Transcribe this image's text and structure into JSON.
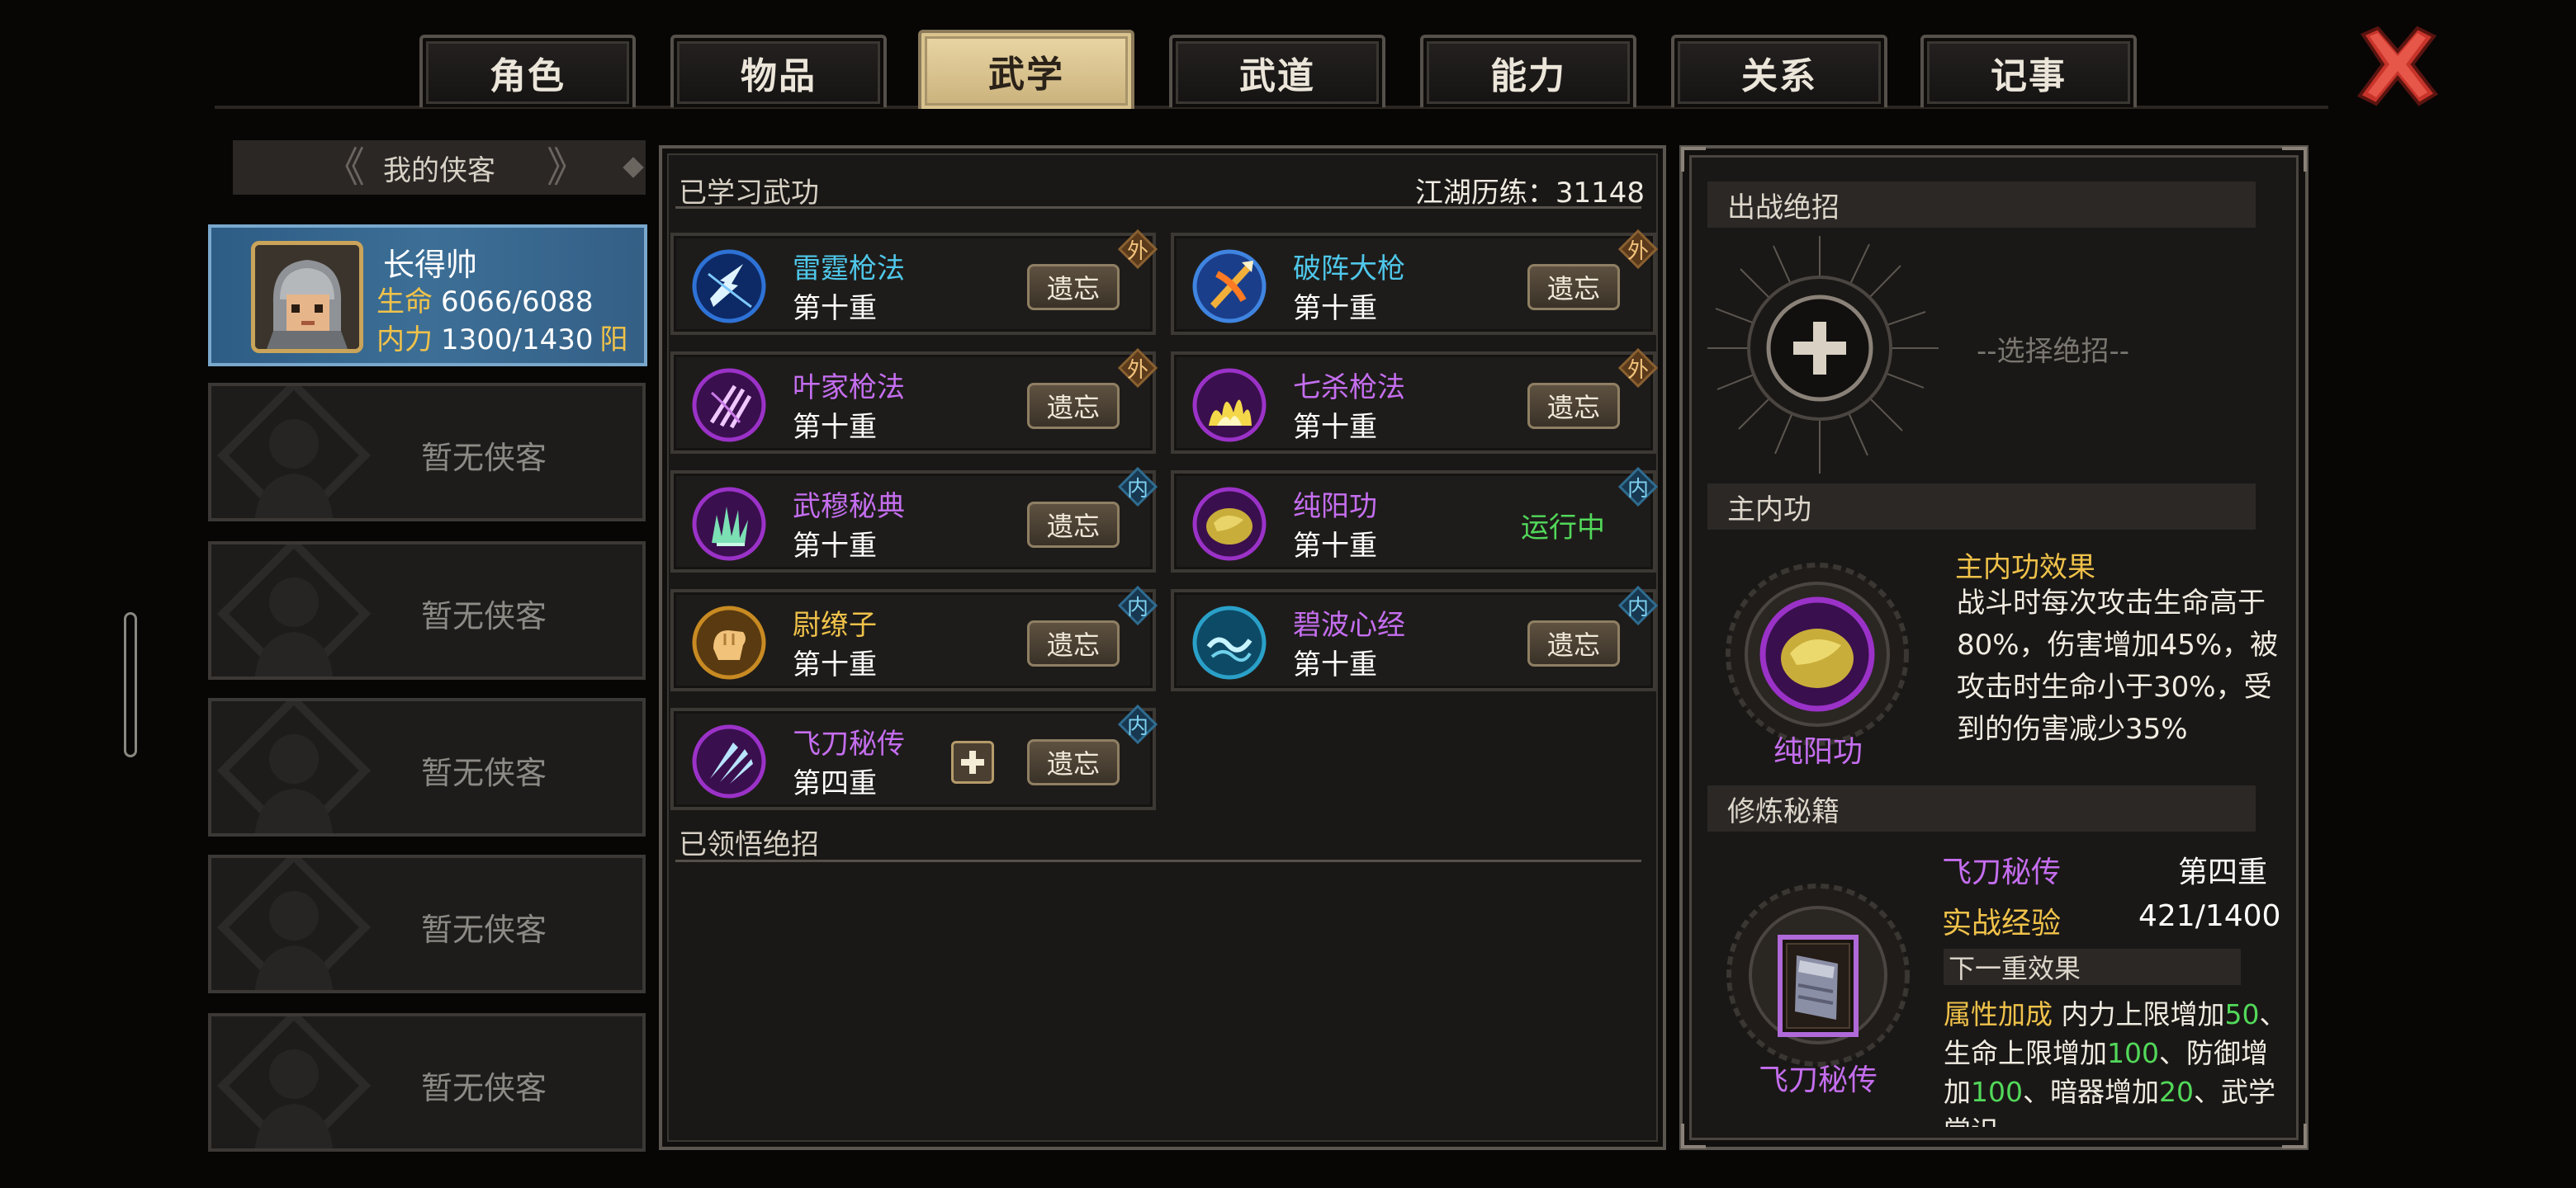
{
  "tabs": [
    "角色",
    "物品",
    "武学",
    "武道",
    "能力",
    "关系",
    "记事"
  ],
  "active_tab_index": 2,
  "sidebar": {
    "header": "我的侠客",
    "hero": {
      "name": "长得帅",
      "hp_label": "生命",
      "hp_value": "6066/6088",
      "mp_label": "内力",
      "mp_value": "1300/1430",
      "alignment": "阳"
    },
    "empty_slots": [
      "暂无侠客",
      "暂无侠客",
      "暂无侠客",
      "暂无侠客",
      "暂无侠客"
    ]
  },
  "middle": {
    "learned_title": "已学习武功",
    "experience_label": "江湖历练：31148",
    "forget_label": "遗忘",
    "skills": [
      {
        "name": "雷霆枪法",
        "level": "第十重",
        "tag": "外",
        "name_color": "#4fc7ea",
        "icon": "lightning-spear-icon",
        "status": ""
      },
      {
        "name": "破阵大枪",
        "level": "第十重",
        "tag": "外",
        "name_color": "#4fc7ea",
        "icon": "spear-burst-icon",
        "status": ""
      },
      {
        "name": "叶家枪法",
        "level": "第十重",
        "tag": "外",
        "name_color": "#c56ef0",
        "icon": "claw-slash-icon",
        "status": ""
      },
      {
        "name": "七杀枪法",
        "level": "第十重",
        "tag": "外",
        "name_color": "#c56ef0",
        "icon": "flame-burst-icon",
        "status": ""
      },
      {
        "name": "武穆秘典",
        "level": "第十重",
        "tag": "内",
        "name_color": "#c56ef0",
        "icon": "jade-hand-icon",
        "status": ""
      },
      {
        "name": "纯阳功",
        "level": "第十重",
        "tag": "内",
        "name_color": "#c56ef0",
        "icon": "golden-qi-icon",
        "status": "运行中"
      },
      {
        "name": "尉缭子",
        "level": "第十重",
        "tag": "内",
        "name_color": "#f0c24a",
        "icon": "fist-icon",
        "status": ""
      },
      {
        "name": "碧波心经",
        "level": "第十重",
        "tag": "内",
        "name_color": "#c56ef0",
        "icon": "wave-heart-icon",
        "status": ""
      },
      {
        "name": "飞刀秘传",
        "level": "第四重",
        "tag": "内",
        "name_color": "#c56ef0",
        "icon": "flying-blade-icon",
        "status": ""
      }
    ],
    "comprehended_title": "已领悟绝招"
  },
  "right": {
    "ultimate_title": "出战绝招",
    "ultimate_hint": "--选择绝招--",
    "main_neigong_title": "主内功",
    "main_neigong_name": "纯阳功",
    "effect_title": "主内功效果",
    "effect_text": "战斗时每次攻击生命高于80%，伤害增加45%，被攻击时生命小于30%，受到的伤害减少35%",
    "training_title": "修炼秘籍",
    "book_name": "飞刀秘传",
    "book_skill": "飞刀秘传",
    "book_level": "第四重",
    "combat_exp_label": "实战经验",
    "combat_exp_value": "421/1400",
    "next_level_title": "下一重效果",
    "next_effect": {
      "label": "属性加成",
      "p1": "内力上限增加",
      "v1": "50",
      "p2": "、生命上限增加",
      "v2": "100",
      "p3": "、防御增加",
      "v3": "100",
      "p4": "、暗器增加",
      "v4": "20",
      "p5": "、武学常识"
    }
  },
  "colors": {
    "gold": "#f0c24a",
    "purple": "#c56ef0",
    "cyan": "#4fc7ea",
    "green": "#52d85a",
    "active_tab": "#e3cf9c"
  }
}
